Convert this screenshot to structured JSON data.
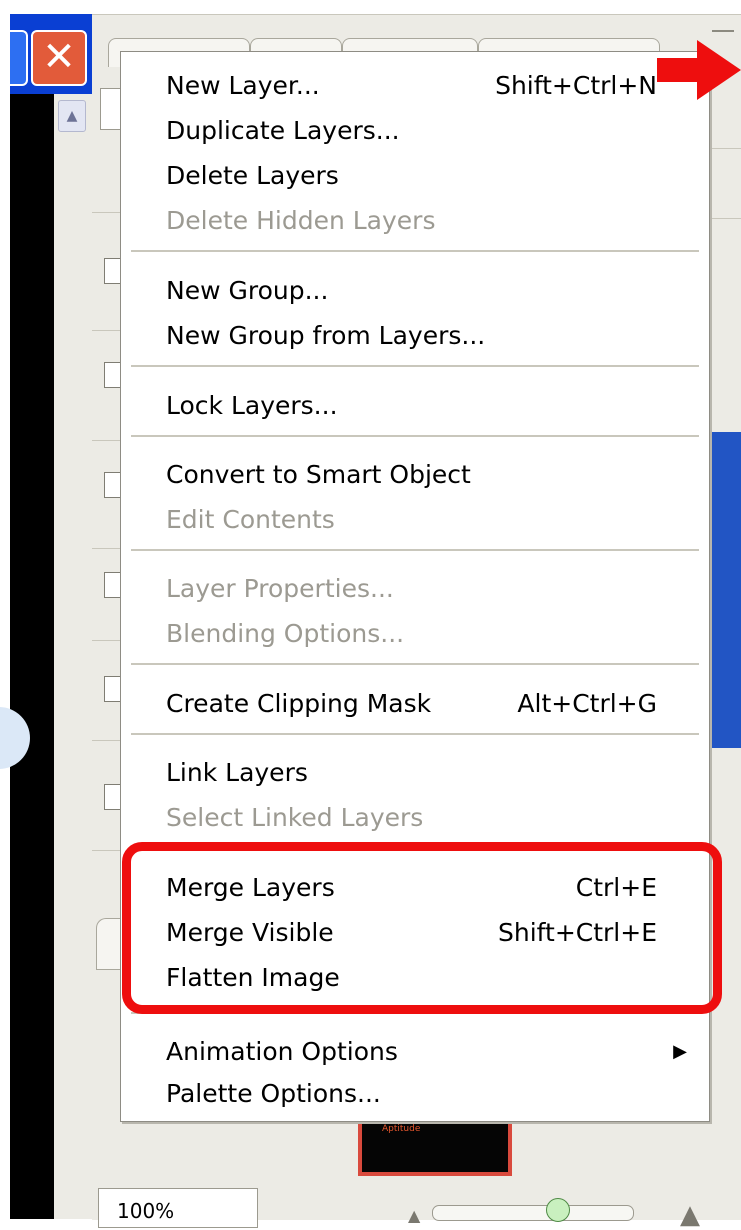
{
  "window": {
    "close_glyph": "✕"
  },
  "scrollbar": {
    "up_glyph": "▲"
  },
  "menu": {
    "groups": [
      [
        {
          "label": "New Layer...",
          "shortcut": "Shift+Ctrl+N",
          "enabled": true
        },
        {
          "label": "Duplicate Layers...",
          "shortcut": "",
          "enabled": true
        },
        {
          "label": "Delete Layers",
          "shortcut": "",
          "enabled": true
        },
        {
          "label": "Delete Hidden Layers",
          "shortcut": "",
          "enabled": false
        }
      ],
      [
        {
          "label": "New Group...",
          "shortcut": "",
          "enabled": true
        },
        {
          "label": "New Group from Layers...",
          "shortcut": "",
          "enabled": true
        }
      ],
      [
        {
          "label": "Lock Layers...",
          "shortcut": "",
          "enabled": true
        }
      ],
      [
        {
          "label": "Convert to Smart Object",
          "shortcut": "",
          "enabled": true
        },
        {
          "label": "Edit Contents",
          "shortcut": "",
          "enabled": false
        }
      ],
      [
        {
          "label": "Layer Properties...",
          "shortcut": "",
          "enabled": false
        },
        {
          "label": "Blending Options...",
          "shortcut": "",
          "enabled": false
        }
      ],
      [
        {
          "label": "Create Clipping Mask",
          "shortcut": "Alt+Ctrl+G",
          "enabled": true
        }
      ],
      [
        {
          "label": "Link Layers",
          "shortcut": "",
          "enabled": true
        },
        {
          "label": "Select Linked Layers",
          "shortcut": "",
          "enabled": false
        }
      ],
      [
        {
          "label": "Merge Layers",
          "shortcut": "Ctrl+E",
          "enabled": true
        },
        {
          "label": "Merge Visible",
          "shortcut": "Shift+Ctrl+E",
          "enabled": true
        },
        {
          "label": "Flatten Image",
          "shortcut": "",
          "enabled": true
        }
      ],
      [
        {
          "label": "Animation Options",
          "shortcut": "",
          "enabled": true,
          "submenu": "▶"
        },
        {
          "label": "Palette Options...",
          "shortcut": "",
          "enabled": true
        }
      ]
    ]
  },
  "palette": {
    "zoom_value": "100%",
    "preview_caption": "Aptitude"
  },
  "colors": {
    "highlight": "#ee0e0e",
    "arrow": "#ee0e0e",
    "disabled_text": "#9c9a92",
    "title_bar": "#0a3fd3",
    "close_button": "#e25b3a"
  }
}
